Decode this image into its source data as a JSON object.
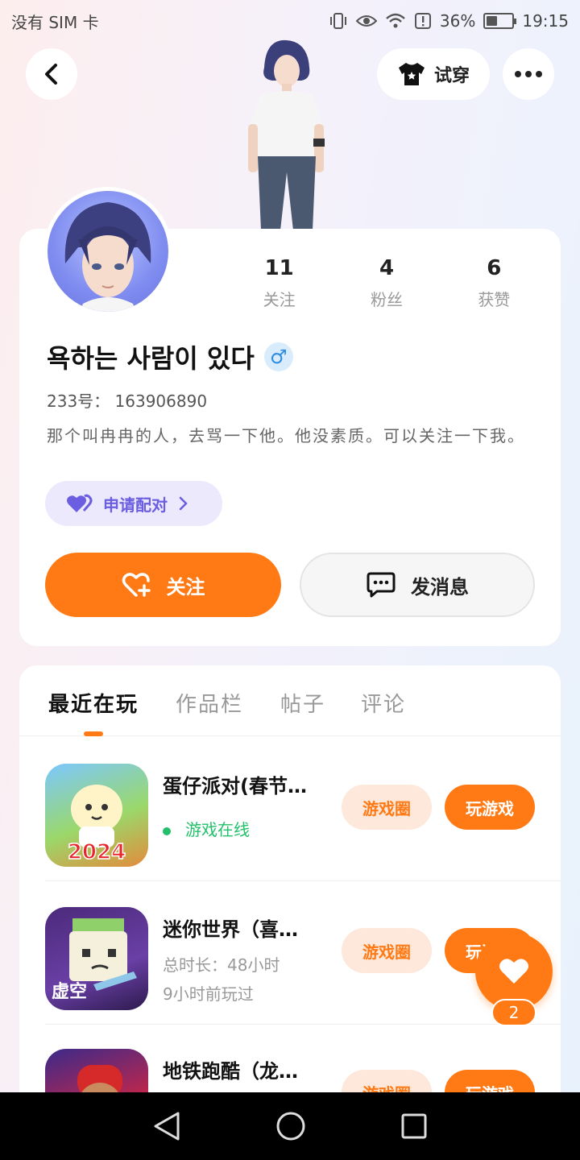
{
  "status_bar": {
    "carrier": "没有 SIM 卡",
    "battery": "36%",
    "time": "19:15"
  },
  "header": {
    "tryon_label": "试穿"
  },
  "profile": {
    "stats": [
      {
        "num": "11",
        "label": "关注"
      },
      {
        "num": "4",
        "label": "粉丝"
      },
      {
        "num": "6",
        "label": "获赞"
      }
    ],
    "username": "욕하는 사람이 있다",
    "gender_symbol": "♂",
    "uid": "233号： 163906890",
    "bio": "那个叫冉冉的人，去骂一下他。他没素质。可以关注一下我。",
    "match_label": "申请配对",
    "follow_label": "关注",
    "message_label": "发消息"
  },
  "tabs": [
    "最近在玩",
    "作品栏",
    "帖子",
    "评论"
  ],
  "games": [
    {
      "title": "蛋仔派对(春节…",
      "sub1": "游戏在线",
      "sub2": "",
      "circle_label": "游戏圈",
      "play_label": "玩游戏",
      "icon_text": "2024"
    },
    {
      "title": "迷你世界（喜…",
      "sub1": "总时长：48小时",
      "sub2": "9小时前玩过",
      "circle_label": "游戏圈",
      "play_label": "玩游戏",
      "icon_text": "虚空"
    },
    {
      "title": "地铁跑酷（龙…",
      "sub1": "",
      "sub2": "",
      "circle_label": "游戏圈",
      "play_label": "玩游戏",
      "icon_text": ""
    }
  ],
  "floating_like": {
    "count": "2"
  },
  "colors": {
    "accent": "#ff7a14",
    "online": "#22c06a",
    "match": "#6b5ee0"
  }
}
